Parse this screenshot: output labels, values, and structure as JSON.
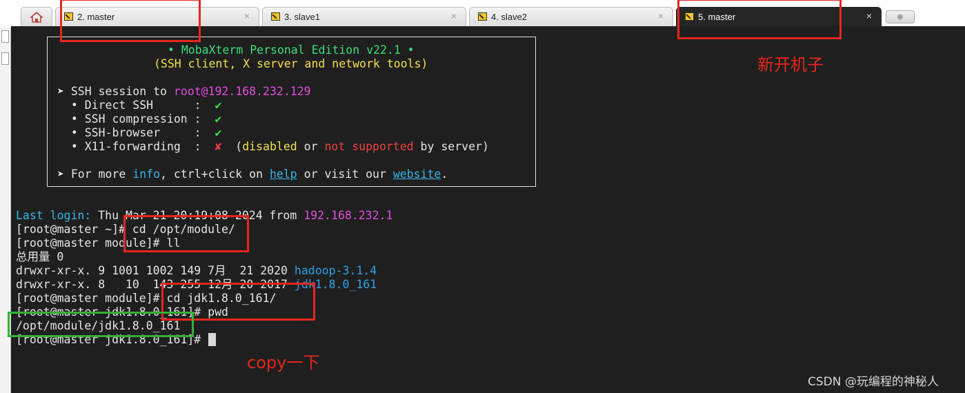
{
  "tabs": [
    {
      "label": "2. master",
      "close": "×"
    },
    {
      "label": "3. slave1",
      "close": "×"
    },
    {
      "label": "4. slave2",
      "close": "×"
    },
    {
      "label": "5. master",
      "close": "×",
      "active": true
    }
  ],
  "home_icon": "home-icon",
  "new_tab_icon": "plus-icon",
  "banner": {
    "title": "• MobaXterm Personal Edition v22.1 •",
    "subtitle": "(SSH client, X server and network tools)",
    "ssh_prefix": "➤ SSH session to ",
    "ssh_target": "root@192.168.232.129",
    "direct_ssh": "  • Direct SSH      :  ",
    "compression": "  • SSH compression :  ",
    "browser": "  • SSH-browser     :  ",
    "x11": "  • X11-forwarding  :  ",
    "check": "✔",
    "cross": "✘",
    "x11_open": "  (",
    "disabled": "disabled",
    "or": " or ",
    "not_supported": "not supported",
    "by_server": " by server)",
    "more_prefix": "➤ For more ",
    "info": "info",
    "ctrl": ", ctrl+click on ",
    "help": "help",
    "visit": " or visit our ",
    "website": "website",
    "period": "."
  },
  "terminal": {
    "last_login_label": "Last login:",
    "last_login_text": " Thu Mar 21 20:19:08 2024 from ",
    "last_login_ip": "192.168.232.1",
    "cmd1": "[root@master ~]# cd /opt/module/",
    "cmd2": "[root@master module]# ll",
    "total": "总用量 0",
    "row1_meta": "drwxr-xr-x. 9 1001 1002 149 7月  21 2020 ",
    "row1_name": "hadoop-3.1.4",
    "row2_meta": "drwxr-xr-x. 8   10  143 255 12月 20 2017 ",
    "row2_name": "jdk1.8.0_161",
    "cmd3": "[root@master module]# cd jdk1.8.0_161/",
    "cmd4": "[root@master jdk1.8.0_161]# pwd",
    "pwd_out": "/opt/module/jdk1.8.0_161",
    "prompt": "[root@master jdk1.8.0_161]# "
  },
  "annotations": {
    "new_machine": "新开机子",
    "copy_note": "copy一下"
  },
  "watermark": "CSDN @玩编程的神秘人",
  "colors": {
    "terminal_bg": "#1f1f1f",
    "annotation_red": "#e8261e",
    "annotation_green": "#34b233"
  }
}
